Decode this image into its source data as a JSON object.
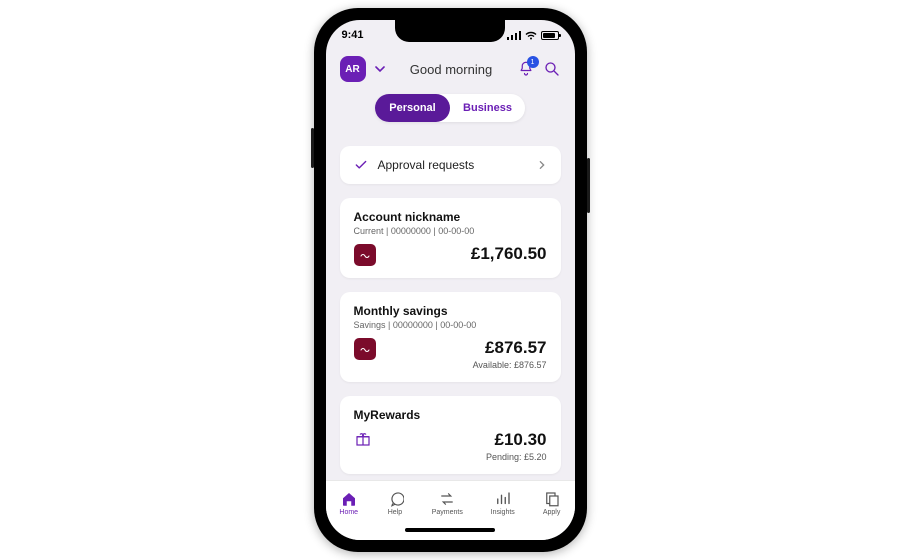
{
  "status": {
    "time": "9:41"
  },
  "header": {
    "avatar_initials": "AR",
    "greeting": "Good morning",
    "notification_count": "1"
  },
  "segments": {
    "personal": "Personal",
    "business": "Business"
  },
  "approval": {
    "label": "Approval requests"
  },
  "accounts": [
    {
      "name": "Account nickname",
      "meta": "Current | 00000000 | 00-00-00",
      "balance": "£1,760.50",
      "available": ""
    },
    {
      "name": "Monthly savings",
      "meta": "Savings | 00000000 | 00-00-00",
      "balance": "£876.57",
      "available": "Available: £876.57"
    },
    {
      "name": "MyRewards",
      "meta": "",
      "balance": "£10.30",
      "available": "Pending: £5.20"
    }
  ],
  "nav": {
    "home": "Home",
    "help": "Help",
    "payments": "Payments",
    "insights": "Insights",
    "apply": "Apply"
  },
  "colors": {
    "brand": "#6b1fb5"
  }
}
